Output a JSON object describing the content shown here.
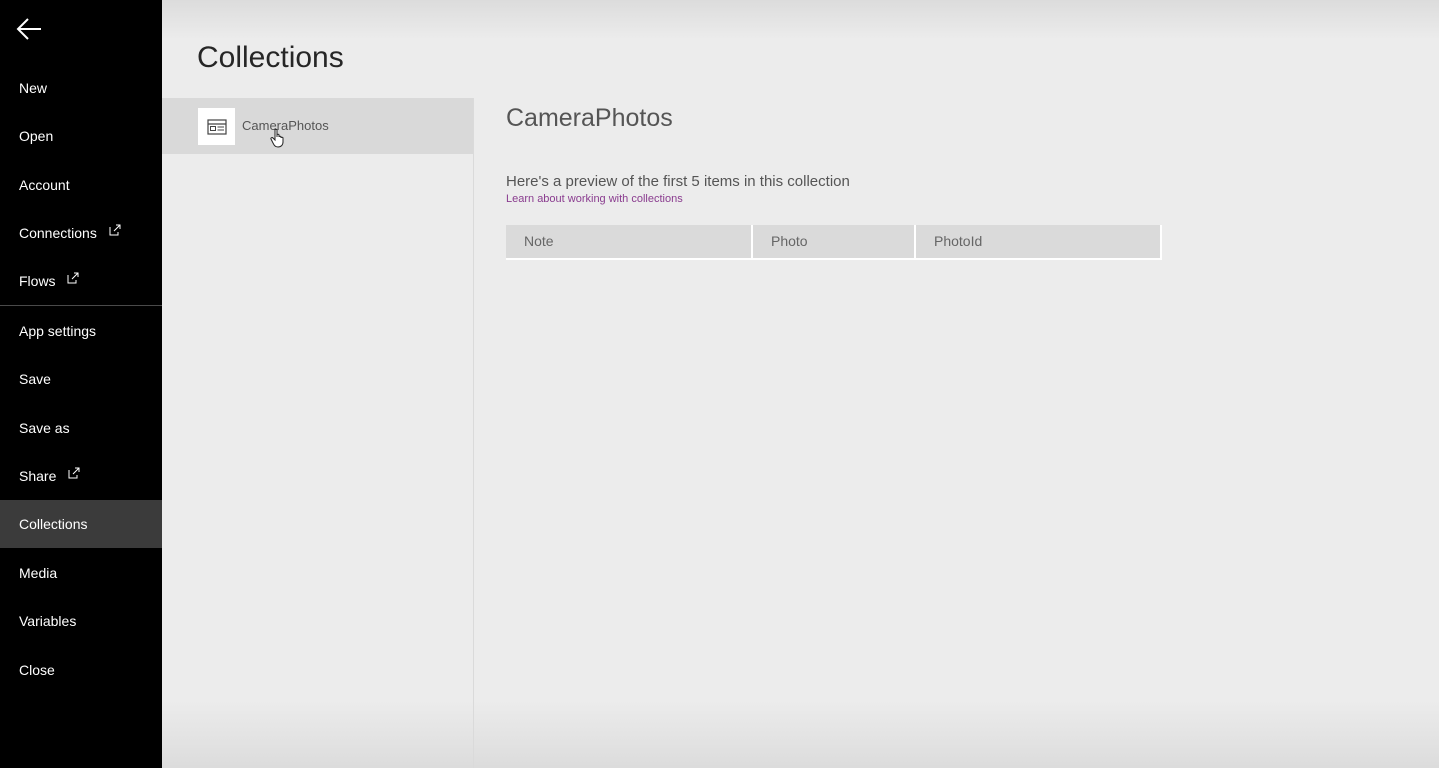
{
  "sidebar": {
    "back_icon": "arrow-left-icon",
    "items": [
      {
        "label": "New"
      },
      {
        "label": "Open"
      },
      {
        "label": "Account"
      },
      {
        "label": "Connections",
        "external": true
      },
      {
        "label": "Flows",
        "external": true
      },
      {
        "label": "App settings"
      },
      {
        "label": "Save"
      },
      {
        "label": "Save as"
      },
      {
        "label": "Share",
        "external": true
      },
      {
        "label": "Collections",
        "active": true
      },
      {
        "label": "Media"
      },
      {
        "label": "Variables"
      },
      {
        "label": "Close"
      }
    ]
  },
  "main": {
    "title": "Collections",
    "collections": [
      {
        "name": "CameraPhotos",
        "icon": "collection-table-icon",
        "selected": true
      }
    ],
    "detail": {
      "title": "CameraPhotos",
      "preview_text": "Here's a preview of the first 5 items in this collection",
      "learn_link": "Learn about working with collections",
      "columns": [
        "Note",
        "Photo",
        "PhotoId"
      ]
    }
  },
  "colors": {
    "sidebar_bg": "#000000",
    "sidebar_active": "#3b3b3b",
    "link": "#8a3c8f",
    "content_bg": "#ececec"
  }
}
